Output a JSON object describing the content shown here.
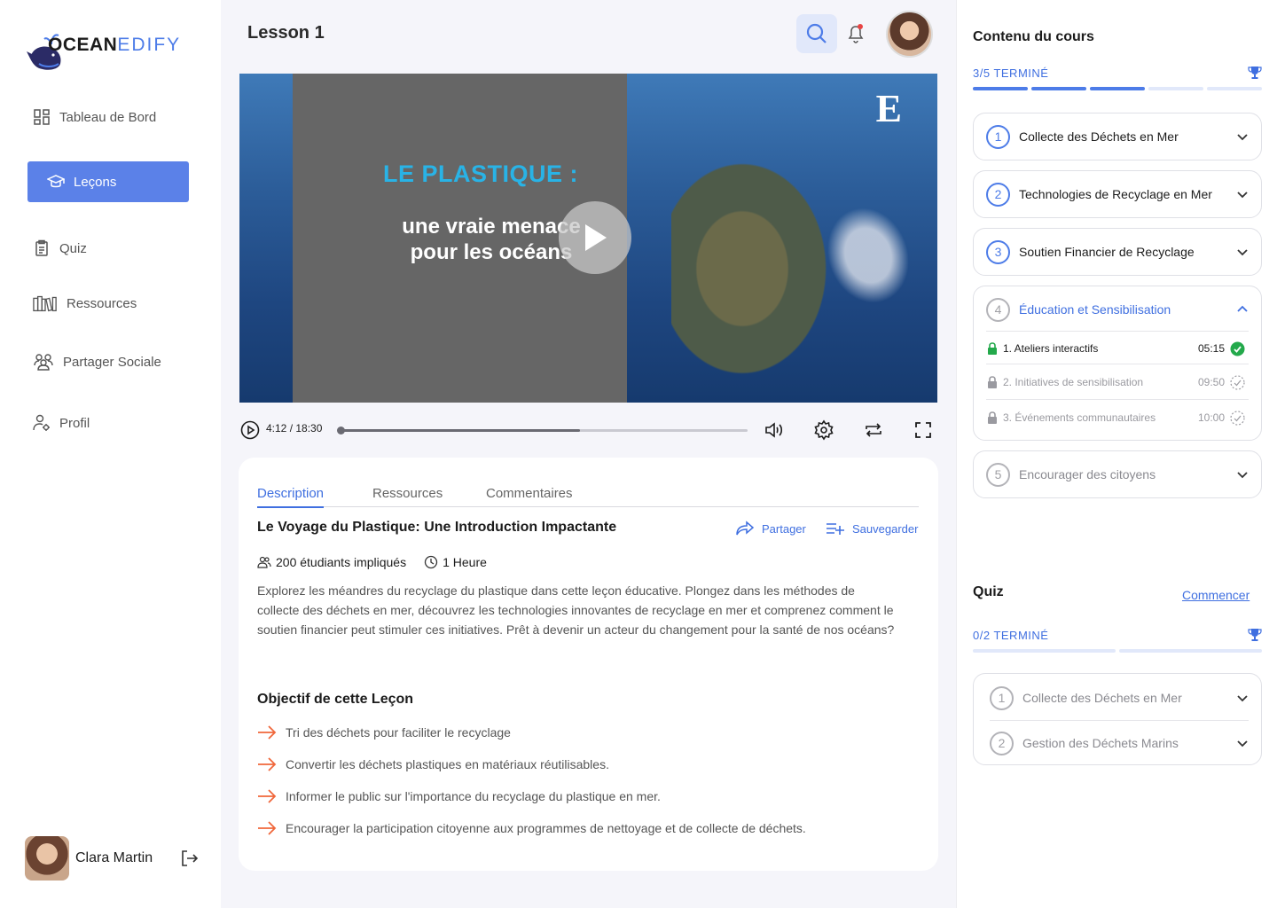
{
  "app": {
    "logo_ocean": "OCEAN",
    "logo_edify": "EDIFY"
  },
  "sidebar": {
    "items": [
      {
        "label": "Tableau de Bord",
        "icon": "dashboard-icon"
      },
      {
        "label": "Leçons",
        "icon": "graduation-cap-icon",
        "active": true
      },
      {
        "label": "Quiz",
        "icon": "clipboard-icon"
      },
      {
        "label": "Ressources",
        "icon": "books-icon"
      },
      {
        "label": "Partager Sociale",
        "icon": "users-icon"
      },
      {
        "label": "Profil",
        "icon": "user-settings-icon"
      }
    ],
    "user_name": "Clara Martin"
  },
  "header": {
    "title": "Lesson 1"
  },
  "video": {
    "overlay_title": "LE PLASTIQUE :",
    "overlay_subtitle_1": "une vraie menace",
    "overlay_subtitle_2": "pour les océans",
    "brand_mark": "E",
    "time": "4:12 / 18:30",
    "progress": 0.59
  },
  "content": {
    "tabs": [
      "Description",
      "Ressources",
      "Commentaires"
    ],
    "active_tab": "Description",
    "lesson_title": "Le Voyage du Plastique: Une Introduction Impactante",
    "share_label": "Partager",
    "save_label": "Sauvegarder",
    "students": "200 étudiants impliqués",
    "duration": "1 Heure",
    "description": "Explorez les méandres du recyclage du plastique dans cette leçon éducative. Plongez dans les méthodes de collecte des déchets en mer, découvrez les technologies innovantes de recyclage en mer et comprenez comment le soutien financier peut stimuler ces initiatives. Prêt à devenir un acteur du changement pour la santé de nos océans?",
    "objectives_title": "Objectif de cette Leçon",
    "objectives": [
      "Tri des déchets pour faciliter le recyclage",
      "Convertir les déchets plastiques en matériaux réutilisables.",
      "Informer le public sur l'importance du recyclage du plastique en mer.",
      "Encourager la participation citoyenne aux programmes de nettoyage et de collecte de déchets."
    ]
  },
  "course": {
    "title": "Contenu du cours",
    "progress_label": "3/5 TERMINÉ",
    "completed": 3,
    "total": 5,
    "modules": [
      {
        "num": "1",
        "label": "Collecte des Déchets en Mer"
      },
      {
        "num": "2",
        "label": "Technologies de Recyclage en Mer"
      },
      {
        "num": "3",
        "label": "Soutien Financier de Recyclage"
      },
      {
        "num": "4",
        "label": "Éducation et Sensibilisation",
        "expanded": true,
        "lessons": [
          {
            "label": "1. Ateliers interactifs",
            "duration": "05:15",
            "done": true
          },
          {
            "label": "2. Initiatives de sensibilisation",
            "duration": "09:50",
            "done": false
          },
          {
            "label": "3. Événements communautaires",
            "duration": "10:00",
            "done": false
          }
        ]
      },
      {
        "num": "5",
        "label": "Encourager des citoyens"
      }
    ]
  },
  "quiz": {
    "title": "Quiz",
    "start_label": "Commencer",
    "progress_label": "0/2 TERMINÉ",
    "items": [
      {
        "num": "1",
        "label": "Collecte des Déchets en Mer"
      },
      {
        "num": "2",
        "label": "Gestion des Déchets Marins"
      }
    ]
  },
  "colors": {
    "accent": "#4d7ce8",
    "success": "#23a94b",
    "arrow": "#f0673b"
  }
}
